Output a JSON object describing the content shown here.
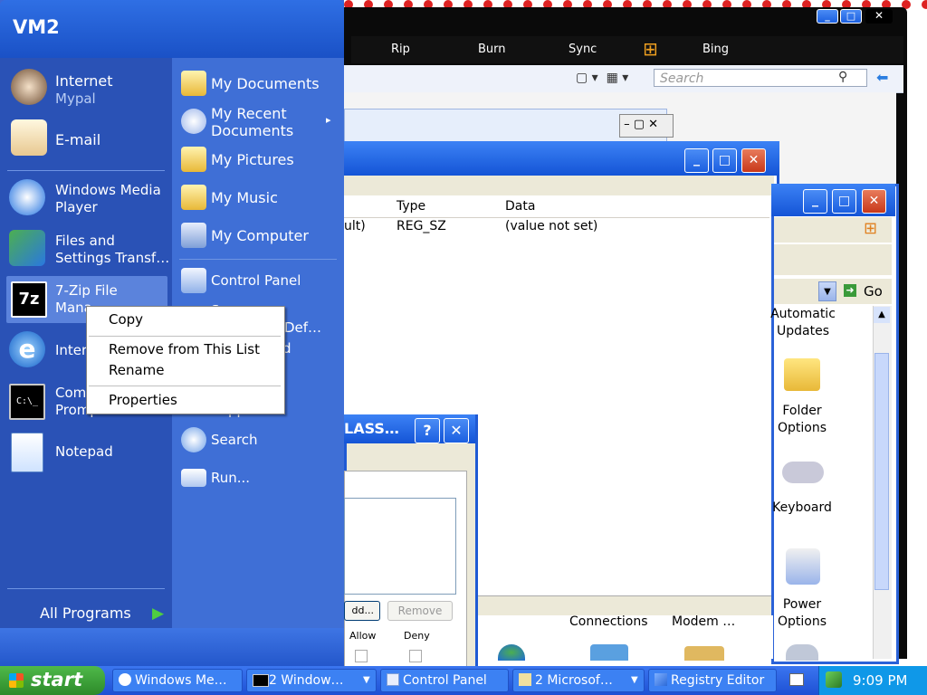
{
  "start_menu": {
    "user": "VM2",
    "pinned": [
      {
        "label": "Internet",
        "sub": "Mypal",
        "icon": "raccoon-browser-icon"
      },
      {
        "label": "E-mail",
        "sub": "",
        "icon": "envelope-icon"
      }
    ],
    "recent": [
      {
        "line1": "Windows Media",
        "line2": "Player",
        "icon": "media-player-icon"
      },
      {
        "line1": "Files and",
        "line2": "Settings Transf…",
        "icon": "transfer-icon"
      },
      {
        "line1": "7-Zip File",
        "line2": "Mana",
        "icon": "7zip-icon"
      },
      {
        "line1": "Inter",
        "line2": "",
        "icon": "internet-explorer-icon"
      },
      {
        "line1": "Com",
        "line2": "Prompt",
        "icon": "command-prompt-icon"
      },
      {
        "line1": "Notepad",
        "line2": "",
        "icon": "notepad-icon"
      }
    ],
    "all_programs": "All Programs",
    "right_items": [
      {
        "label": "My Documents",
        "icon": "folder-documents-icon"
      },
      {
        "label": "My Recent Documents",
        "line1": "My Recent",
        "line2": "Documents",
        "icon": "recent-documents-icon"
      },
      {
        "label": "My Pictures",
        "icon": "folder-pictures-icon"
      },
      {
        "label": "My Music",
        "icon": "folder-music-icon"
      },
      {
        "label": "My Computer",
        "icon": "computer-icon"
      },
      {
        "label": "Control Panel",
        "icon": "control-panel-icon"
      },
      {
        "label": "Set Program Access and Defaults",
        "line1": "S…  n",
        "line2": "Def…",
        "icon": "program-access-icon"
      },
      {
        "label": "Printers and Faxes",
        "line1": "d",
        "icon": "printer-icon"
      },
      {
        "label": "Help and Support",
        "line1": "Support",
        "icon": "help-icon"
      },
      {
        "label": "Search",
        "icon": "search-icon"
      },
      {
        "label": "Run...",
        "icon": "run-icon"
      }
    ]
  },
  "context_menu": {
    "items": [
      "Copy",
      "Remove from This List",
      "Rename",
      "Properties"
    ]
  },
  "media_player": {
    "nav": [
      "Rip",
      "Burn",
      "Sync",
      "Bing"
    ],
    "search_placeholder": "Search"
  },
  "registry": {
    "columns": [
      "Type",
      "Data"
    ],
    "row": {
      "name": "ult)",
      "type": "REG_SZ",
      "data": "(value not set)"
    }
  },
  "control_panel": {
    "go_label": "Go",
    "icons": [
      {
        "line1": "Automatic",
        "line2": "Updates",
        "icon": "automatic-updates-icon"
      },
      {
        "line1": "Folder",
        "line2": "Options",
        "icon": "folder-options-icon"
      },
      {
        "line1": "Keyboard",
        "line2": "",
        "icon": "keyboard-icon"
      },
      {
        "line1": "Power",
        "line2": "Options",
        "icon": "power-options-icon"
      }
    ],
    "bottom_labels": [
      "Connections",
      "Modem …"
    ]
  },
  "dialog": {
    "title": "LASS…",
    "add_label": "dd...",
    "remove_label": "Remove",
    "allow": "Allow",
    "deny": "Deny"
  },
  "taskbar": {
    "start_label": "start",
    "buttons": [
      {
        "label": "Windows Me…",
        "icon": "media-player-icon"
      },
      {
        "label": "2 Window…",
        "icon": "command-prompt-icon"
      },
      {
        "label": "Control Panel",
        "icon": "control-panel-icon"
      },
      {
        "label": "2 Microsof…",
        "icon": "microsoft-icon"
      },
      {
        "label": "Registry Editor",
        "icon": "registry-editor-icon"
      }
    ],
    "clock": "9:09 PM"
  }
}
